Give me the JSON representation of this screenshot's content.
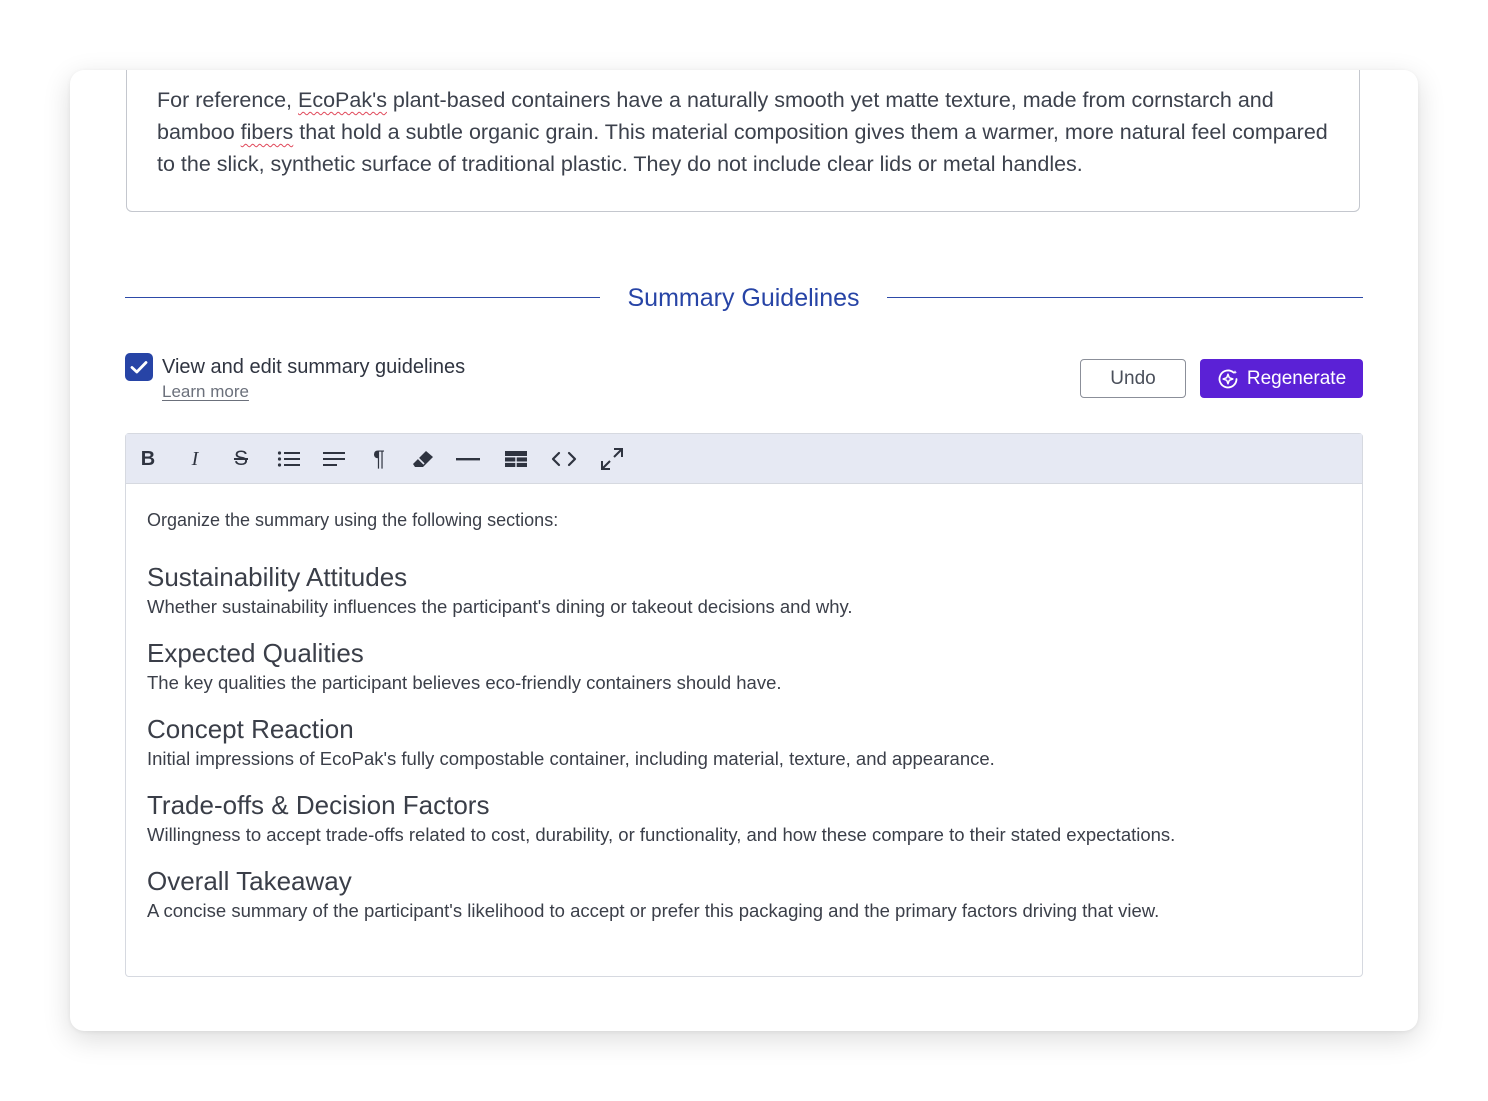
{
  "reference": {
    "text_parts": [
      "For reference, ",
      "EcoPak's",
      " plant-based containers have a naturally smooth yet matte texture, made from cornstarch and bamboo ",
      "fibers",
      " that hold a subtle organic grain. This material composition gives them a warmer, more natural feel compared to the slick, synthetic surface of traditional plastic. They do not include clear lids or metal handles."
    ]
  },
  "guidelines": {
    "section_title": "Summary Guidelines",
    "checkbox_label": "View and edit summary guidelines",
    "checkbox_checked": true,
    "learn_more": "Learn more",
    "undo_label": "Undo",
    "regenerate_label": "Regenerate"
  },
  "toolbar": {
    "bold": "B",
    "italic": "I",
    "strike": "S",
    "paragraph": "¶",
    "icons": [
      "bold-icon",
      "italic-icon",
      "strikethrough-icon",
      "bullet-list-icon",
      "align-icon",
      "paragraph-icon",
      "eraser-icon",
      "horizontal-rule-icon",
      "table-icon",
      "code-icon",
      "expand-icon"
    ]
  },
  "editor": {
    "intro": "Organize the summary using the following sections:",
    "sections": [
      {
        "heading": "Sustainability Attitudes",
        "body": "Whether sustainability influences the participant's dining or takeout decisions and why."
      },
      {
        "heading": "Expected Qualities",
        "body": "The key qualities the participant believes eco-friendly containers should have."
      },
      {
        "heading": "Concept Reaction",
        "body": "Initial impressions of EcoPak's fully compostable container, including material, texture, and appearance."
      },
      {
        "heading": "Trade-offs & Decision Factors",
        "body": "Willingness to accept trade-offs related to cost, durability, or functionality, and how these compare to their stated expectations."
      },
      {
        "heading": "Overall Takeaway",
        "body": "A concise summary of the participant's likelihood to accept or prefer this packaging and the primary factors driving that view."
      }
    ]
  },
  "colors": {
    "accent": "#2744a6",
    "regenerate": "#5b21d6",
    "toolbar_bg": "#e6e9f3",
    "spellcheck": "#e0485a"
  }
}
